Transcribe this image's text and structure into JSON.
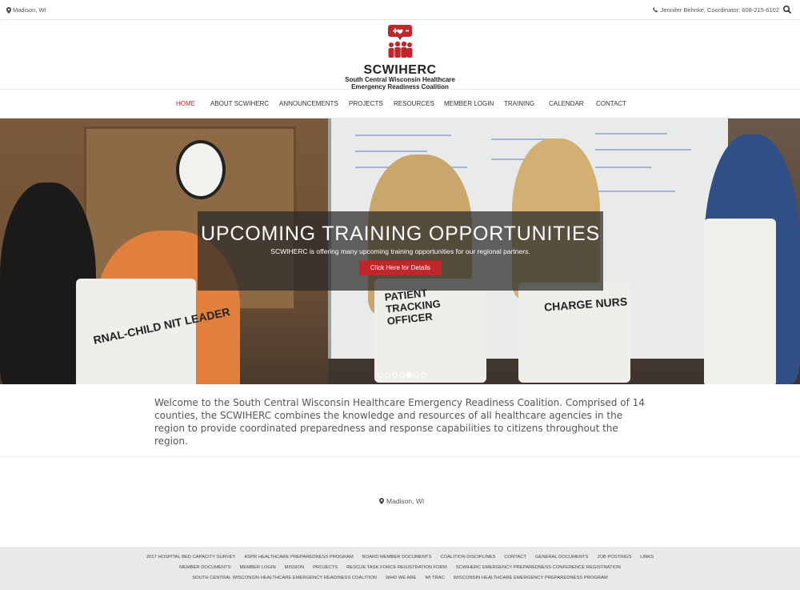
{
  "topbar": {
    "location": "Madison, WI",
    "contact": "Jennifer Behnke, Coordinator: 608-215-6102"
  },
  "logo": {
    "name": "SCWIHERC",
    "line1": "South Central Wisconsin Healthcare",
    "line2": "Emergency Readiness Coalition",
    "accent_color": "#c0272d"
  },
  "nav": {
    "items": [
      {
        "label": "HOME",
        "active": true
      },
      {
        "label": "ABOUT SCWIHERC"
      },
      {
        "label": "ANNOUNCEMENTS"
      },
      {
        "label": "PROJECTS"
      },
      {
        "label": "RESOURCES"
      },
      {
        "label": "MEMBER LOGIN"
      },
      {
        "label": "TRAINING"
      },
      {
        "label": "CALENDAR"
      },
      {
        "label": "CONTACT"
      }
    ],
    "active_color": "#b22b2b"
  },
  "hero": {
    "headline": "UPCOMING TRAINING OPPORTUNITIES",
    "text": "SCWIHERC is offering many upcoming training opportunities for our regional partners.",
    "button": "Click Here for Details",
    "vest_texts": [
      "PATIENT TRACKING OFFICER",
      "CHARGE NURS",
      "RNAL-CHILD NIT LEADER"
    ],
    "slides_total": 7,
    "slide_active": 5
  },
  "intro": {
    "text": "Welcome to the South Central Wisconsin Healthcare Emergency Readiness Coalition. Comprised of 14 counties, the SCWIHERC combines the knowledge and resources of all healthcare agencies in the region to provide coordinated preparedness and response capabilities to citizens throughout the region."
  },
  "footer": {
    "location": "Madison, WI",
    "links_row1": [
      "2017 HOSPITAL BED CAPACITY SURVEY",
      "ASPR HEALTHCARE PREPAREDNESS PROGRAM",
      "BOARD MEMBER DOCUMENTS",
      "COALITION DISCIPLINES",
      "CONTACT",
      "GENERAL DOCUMENTS",
      "JOB POSTINGS",
      "LINKS"
    ],
    "links_row2": [
      "MEMBER DOCUMENTS",
      "MEMBER LOGIN",
      "MISSION",
      "PROJECTS",
      "RESCUE TASK FORCE REGISTRATION FORM",
      "SCWIHERC EMERGENCY PREPAREDNESS CONFERENCE REGISTRATION"
    ],
    "links_row3": [
      "SOUTH CENTRAL WISCONSIN HEALTHCARE EMERGENCY READINESS COALITION",
      "WHO WE ARE",
      "WI TRAC",
      "WISCONSIN HEALTHCARE EMERGENCY PREPAREDNESS PROGRAM"
    ]
  }
}
